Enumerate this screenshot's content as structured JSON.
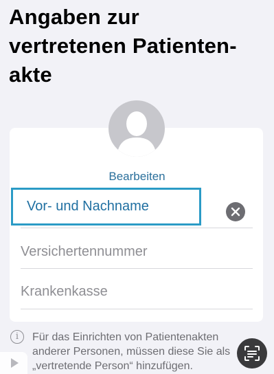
{
  "header": {
    "title": "Angaben zur\nvertretenen Patienten-\nakte"
  },
  "profile": {
    "edit_label": "Bearbeiten"
  },
  "form": {
    "name_value": "Vor- und Nachname",
    "insurance_number_placeholder": "Versichertennummer",
    "health_insurer_placeholder": "Krankenkasse"
  },
  "info": {
    "text": "Für das Einrichten von Patientenakten\nanderer Personen, müssen diese Sie als\n„vertretende Person“ hinzufügen."
  },
  "icons": {
    "avatar": "person-silhouette-icon",
    "clear": "clear-x-icon",
    "info": "info-circle-icon",
    "play": "play-icon",
    "scan": "text-scan-icon"
  },
  "colors": {
    "accent_link": "#2a6f9b",
    "focus_border": "#2b9bc6",
    "background": "#f2f2f7"
  }
}
